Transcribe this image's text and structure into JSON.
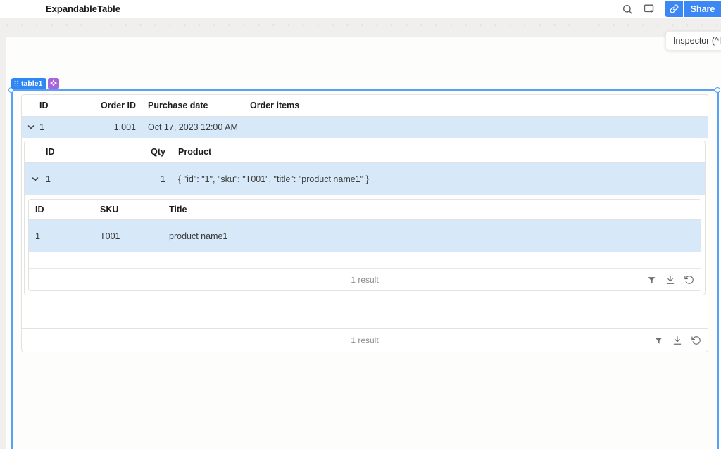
{
  "topbar": {
    "title": "ExpandableTable",
    "share_label": "Share",
    "accent_color": "#3b87f6"
  },
  "inspector_tooltip": "Inspector (^I",
  "component": {
    "badge_label": "table1",
    "badge_color": "#2e87f2",
    "ai_badge_color": "#a765d9",
    "selection_color": "#57a1f7"
  },
  "colors": {
    "selected_row": "#d7e8f9",
    "card_border": "#e3e2e1"
  },
  "outer_table": {
    "headers": [
      "ID",
      "Order ID",
      "Purchase date",
      "Order items"
    ],
    "rows": [
      {
        "id": "1",
        "order_id": "1,001",
        "purchase_date": "Oct 17, 2023 12:00 AM",
        "order_items": ""
      }
    ],
    "footer_results": "1 result"
  },
  "qty_table": {
    "headers": [
      "ID",
      "Qty",
      "Product"
    ],
    "rows": [
      {
        "id": "1",
        "qty": "1",
        "product": "{ \"id\": \"1\", \"sku\": \"T001\", \"title\": \"product name1\" }"
      }
    ]
  },
  "product_table": {
    "headers": [
      "ID",
      "SKU",
      "Title"
    ],
    "rows": [
      {
        "id": "1",
        "sku": "T001",
        "title": "product name1"
      }
    ],
    "footer_results": "1 result"
  }
}
